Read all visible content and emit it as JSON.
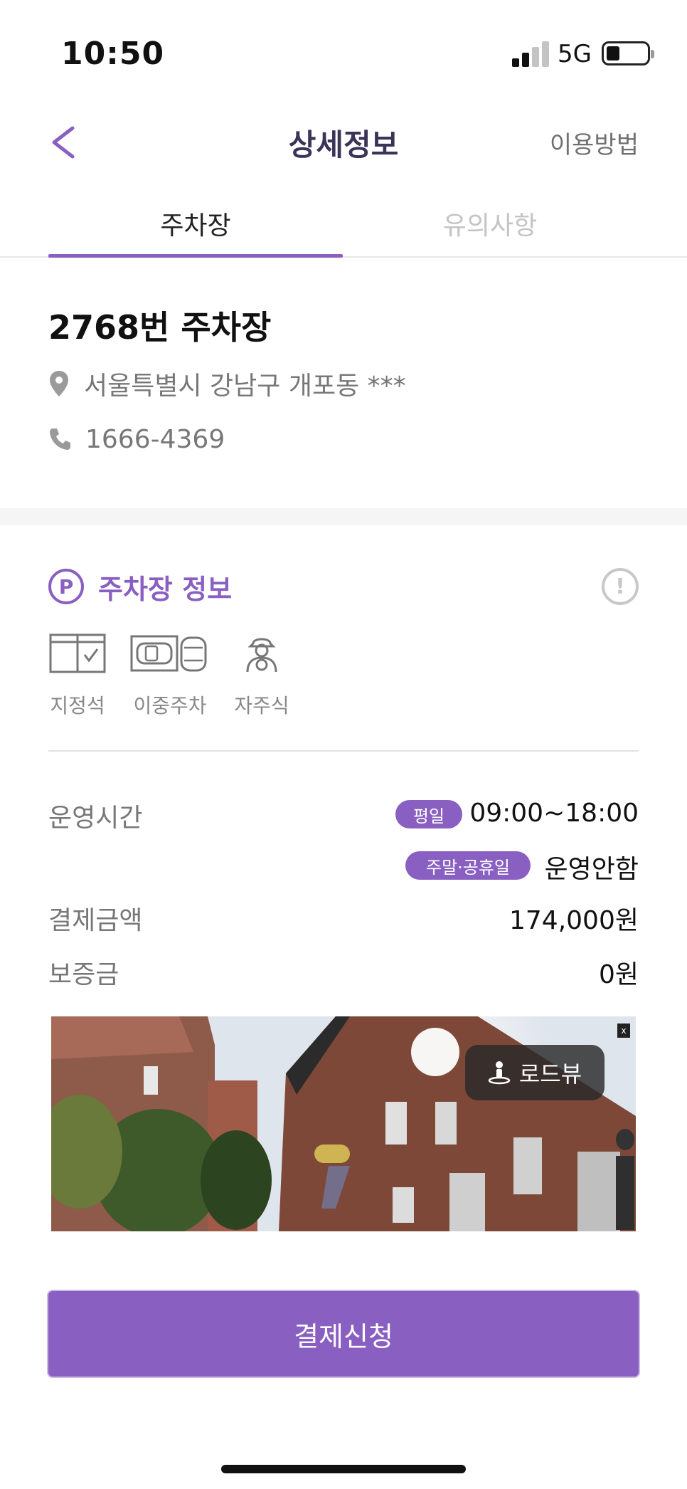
{
  "status_bar": {
    "time": "10:50",
    "network": "5G",
    "battery_level": 0.25
  },
  "nav": {
    "title": "상세정보",
    "help_label": "이용방법"
  },
  "tabs": [
    {
      "label": "주차장",
      "active": true
    },
    {
      "label": "유의사항",
      "active": false
    }
  ],
  "lot": {
    "name": "2768번 주차장",
    "address": "서울특별시 강남구 개포동 ***",
    "phone": "1666-4369"
  },
  "section": {
    "icon_letter": "P",
    "title": "주차장 정보",
    "alert_glyph": "!",
    "features": [
      {
        "icon": "reserved-seat-icon",
        "label": "지정석"
      },
      {
        "icon": "double-parking-icon",
        "label": "이중주차"
      },
      {
        "icon": "self-parking-icon",
        "label": "자주식"
      }
    ]
  },
  "details": {
    "hours_label": "운영시간",
    "weekday_badge": "평일",
    "weekday_hours": "09:00~18:00",
    "weekend_badge": "주말·공휴일",
    "weekend_hours": "운영안함",
    "price_label": "결제금액",
    "price_value": "174,000원",
    "deposit_label": "보증금",
    "deposit_value": "0원"
  },
  "roadview": {
    "button_label": "로드뷰",
    "close_label": "x"
  },
  "pay_button": "결제신청",
  "colors": {
    "accent": "#8a5fc2",
    "title": "#3b3458",
    "muted": "#777777",
    "inactive_tab": "#c4c4c4"
  }
}
